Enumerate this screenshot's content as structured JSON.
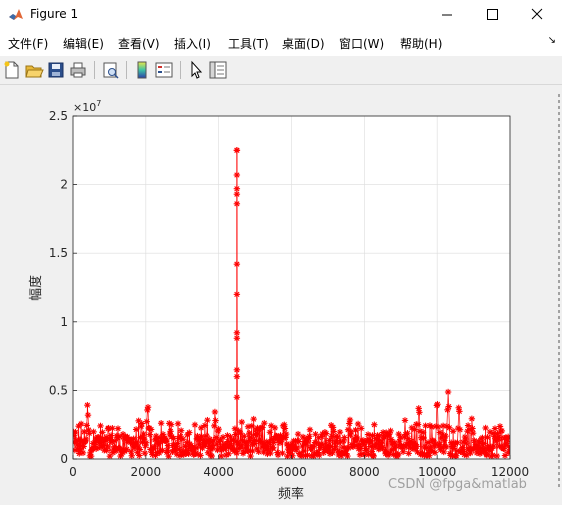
{
  "window": {
    "title": "Figure 1",
    "minimize_icon": "minimize-icon",
    "maximize_icon": "maximize-icon",
    "close_icon": "close-icon"
  },
  "menu": {
    "items": [
      "文件(F)",
      "编辑(E)",
      "查看(V)",
      "插入(I)",
      "工具(T)",
      "桌面(D)",
      "窗口(W)",
      "帮助(H)"
    ]
  },
  "toolbar": {
    "icons": [
      "new-figure-icon",
      "open-file-icon",
      "save-icon",
      "print-icon",
      "print-preview-icon",
      "colorbar-icon",
      "legend-icon",
      "pointer-icon",
      "property-inspector-icon"
    ]
  },
  "chart_data": {
    "type": "line",
    "marker": "*",
    "color": "#ff0000",
    "xlabel": "频率",
    "ylabel": "幅度",
    "xlim": [
      0,
      12000
    ],
    "ylim": [
      0,
      2.5
    ],
    "y_exponent": "×10^7",
    "exponent_label_base": "×10",
    "exponent_label_power": "7",
    "xticks": [
      "0",
      "2000",
      "4000",
      "6000",
      "8000",
      "10000",
      "12000"
    ],
    "yticks": [
      "0",
      "0.5",
      "1",
      "1.5",
      "2",
      "2.5"
    ],
    "grid": true,
    "peak": {
      "x": 4500,
      "y": 2.25
    },
    "peak_markers": [
      2.25,
      2.07,
      1.97,
      1.93,
      1.86,
      1.42,
      1.2,
      0.92,
      0.88,
      0.65,
      0.6,
      0.45
    ],
    "noise_floor_top": 0.28,
    "notable_peaks": [
      {
        "x": 400,
        "y": 0.45
      },
      {
        "x": 2050,
        "y": 0.46
      },
      {
        "x": 10300,
        "y": 0.56
      },
      {
        "x": 10000,
        "y": 0.48
      },
      {
        "x": 10600,
        "y": 0.45
      },
      {
        "x": 3900,
        "y": 0.38
      },
      {
        "x": 9500,
        "y": 0.42
      }
    ]
  },
  "watermark": "CSDN @fpga&matlab"
}
